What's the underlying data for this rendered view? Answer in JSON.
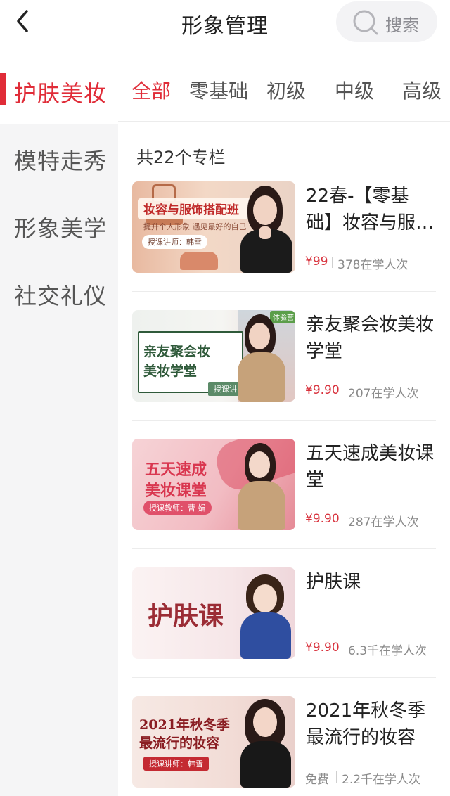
{
  "header": {
    "title": "形象管理",
    "search_label": "搜索"
  },
  "sidebar": {
    "items": [
      {
        "label": "护肤美妆",
        "active": true
      },
      {
        "label": "模特走秀",
        "active": false
      },
      {
        "label": "形象美学",
        "active": false
      },
      {
        "label": "社交礼仪",
        "active": false
      }
    ]
  },
  "tabs": [
    {
      "label": "全部",
      "active": true
    },
    {
      "label": "零基础",
      "active": false
    },
    {
      "label": "初级",
      "active": false
    },
    {
      "label": "中级",
      "active": false
    },
    {
      "label": "高级",
      "active": false
    }
  ],
  "content": {
    "count_label": "共22个专栏",
    "courses": [
      {
        "title": "22春-【零基础】妆容与服…",
        "price": "¥99",
        "learners": "378在学人次",
        "thumb": {
          "caption": "妆容与服饰搭配班",
          "sub": "提升个人形象 遇见最好的自己",
          "teacher": "授课讲师：韩雪"
        }
      },
      {
        "title": "亲友聚会妆美妆学堂",
        "price": "¥9.90",
        "learners": "207在学人次",
        "thumb": {
          "caption_line1": "亲友聚会妆",
          "caption_line2": "美妆学堂",
          "teacher": "授课讲师：曹 娟",
          "tag": "体验营"
        }
      },
      {
        "title": "五天速成美妆课堂",
        "price": "¥9.90",
        "learners": "287在学人次",
        "thumb": {
          "caption_line1": "五天速成",
          "caption_line2": "美妆课堂",
          "teacher": "授课教师：曹 娟"
        }
      },
      {
        "title": "护肤课",
        "price": "¥9.90",
        "learners": "6.3千在学人次",
        "thumb": {
          "caption": "护肤课"
        }
      },
      {
        "title": "2021年秋冬季最流行的妆容",
        "price": "免费",
        "learners": "2.2千在学人次",
        "thumb": {
          "caption_line1": "2021年秋冬季",
          "caption_line2": "最流行的妆容",
          "teacher": "授课讲师：韩雪"
        }
      }
    ]
  },
  "colors": {
    "accent": "#e02c38",
    "sidebar_bg": "#f5f5f6",
    "muted_text": "#8a8a8a"
  }
}
